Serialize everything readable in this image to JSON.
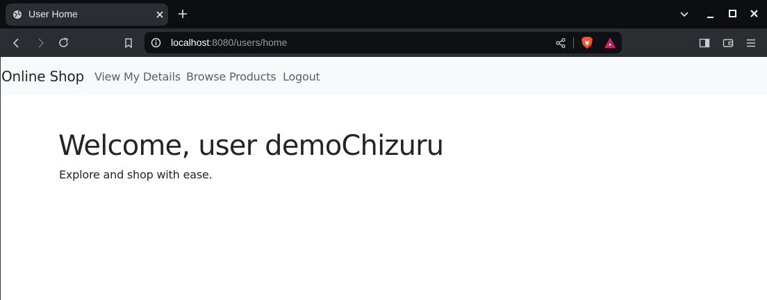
{
  "browser": {
    "tab": {
      "title": "User Home"
    },
    "address": {
      "host": "localhost",
      "path": ":8080/users/home"
    }
  },
  "navbar": {
    "brand": "Online Shop",
    "links": [
      {
        "label": "View My Details"
      },
      {
        "label": "Browse Products"
      },
      {
        "label": "Logout"
      }
    ]
  },
  "main": {
    "heading": "Welcome, user demoChizuru",
    "tagline": "Explore and shop with ease."
  }
}
